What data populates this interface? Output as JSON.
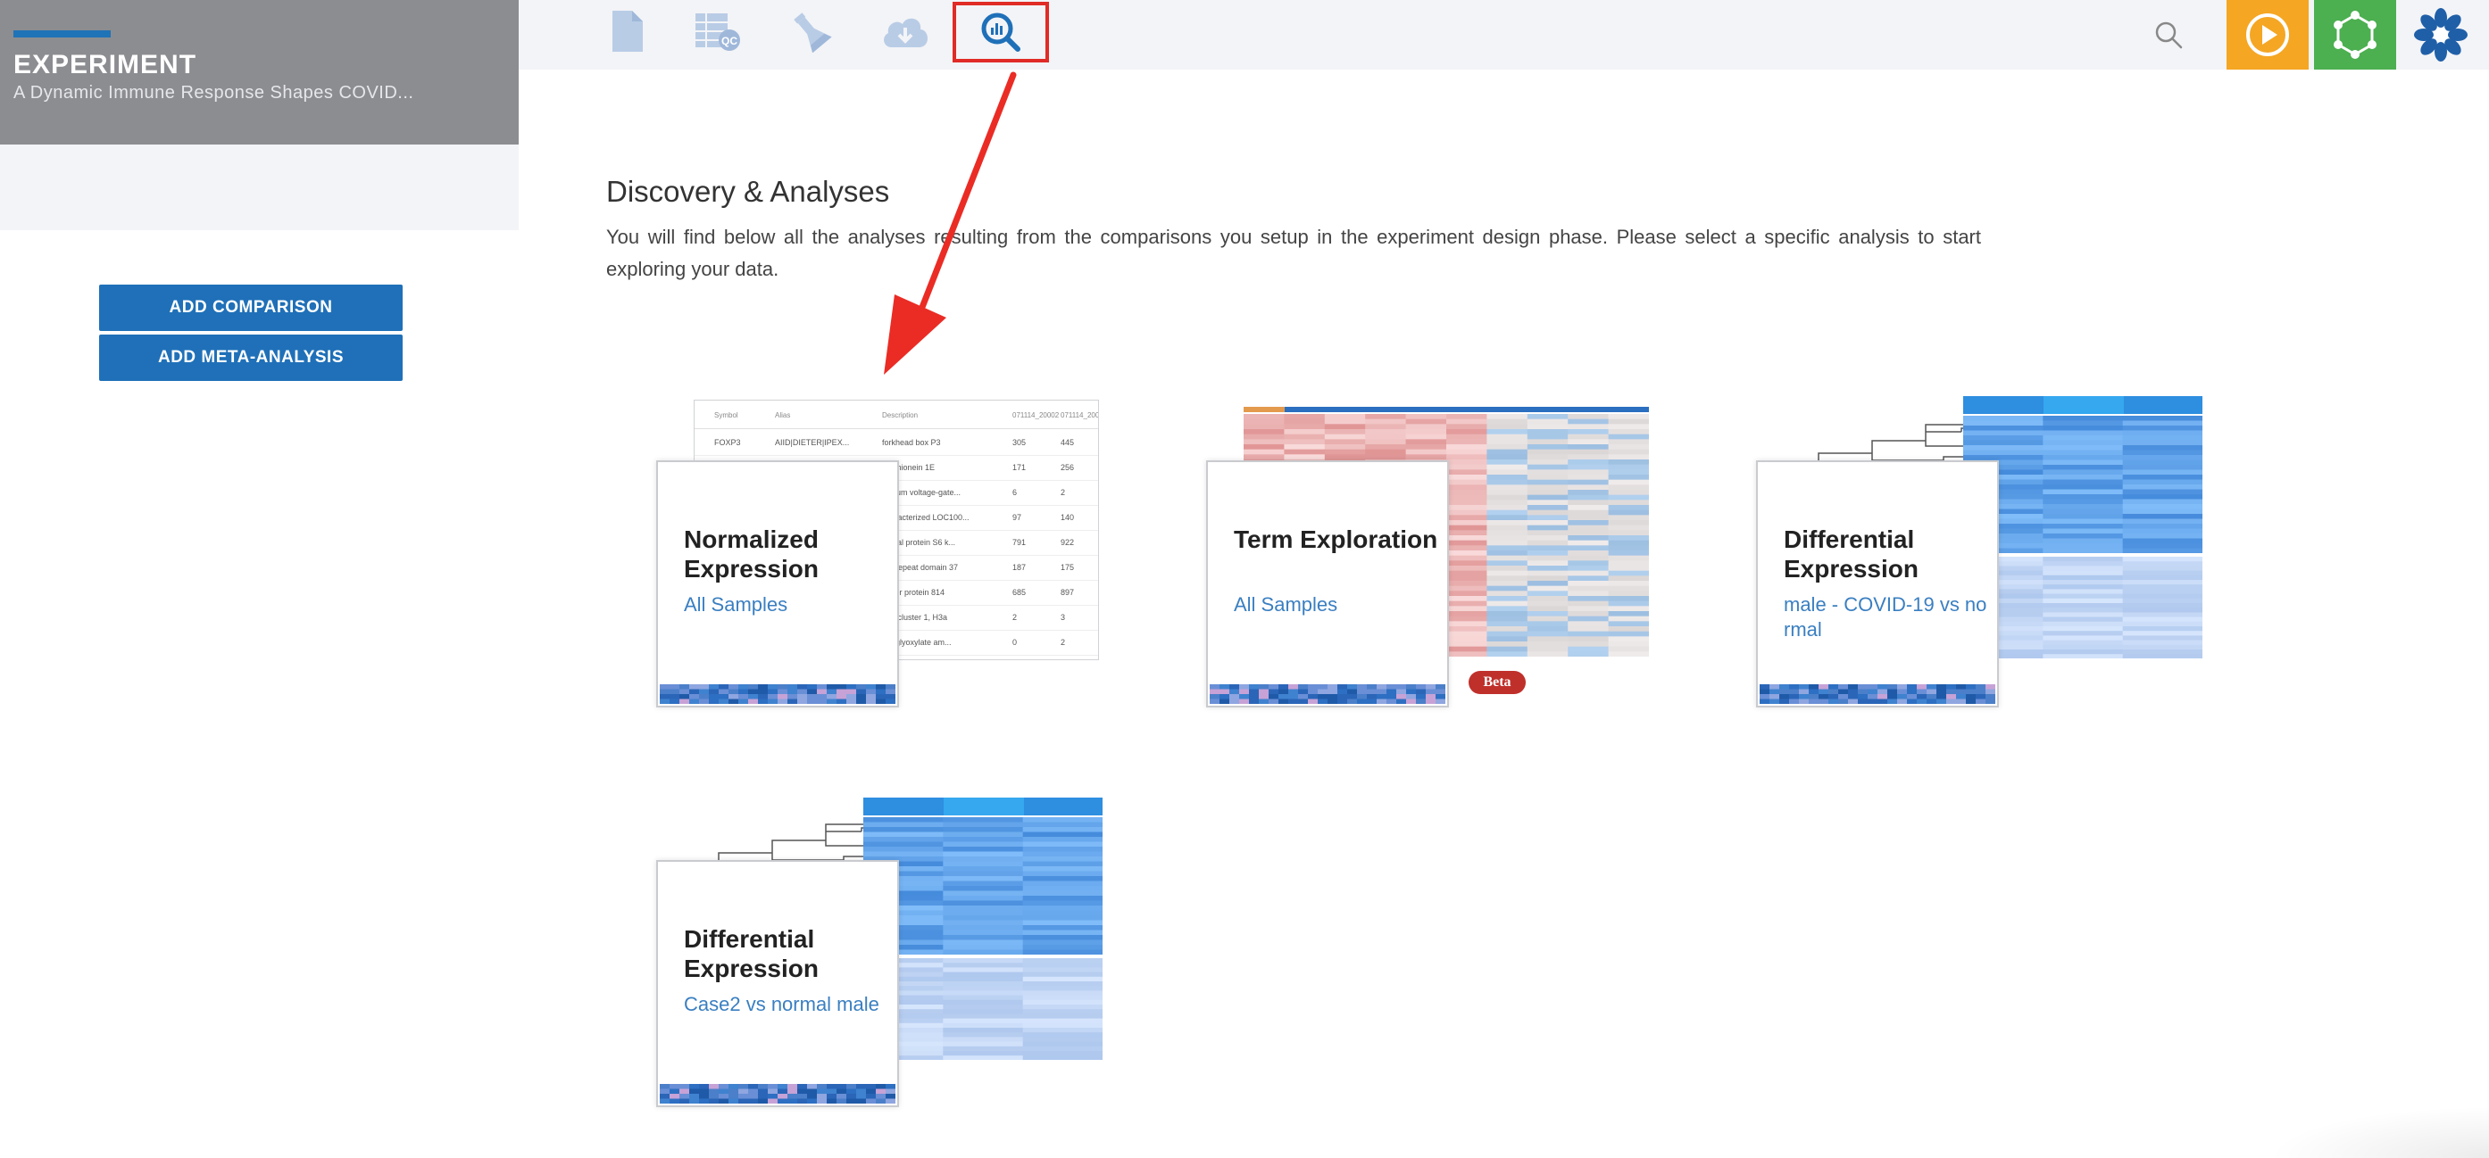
{
  "sidebar": {
    "title": "EXPERIMENT",
    "subtitle": "A Dynamic Immune Response Shapes COVID...",
    "buttons": [
      {
        "label": "ADD COMPARISON"
      },
      {
        "label": "ADD META-ANALYSIS"
      }
    ]
  },
  "topnav": {
    "icons": [
      {
        "name": "document-icon"
      },
      {
        "name": "table-qc-icon"
      },
      {
        "name": "flask-icon"
      },
      {
        "name": "cloud-download-icon"
      },
      {
        "name": "analysis-search-icon",
        "active": true
      }
    ],
    "right": [
      {
        "name": "search-icon"
      },
      {
        "name": "play-icon",
        "color": "#f5a623"
      },
      {
        "name": "network-icon",
        "color": "#4caf50"
      },
      {
        "name": "app-logo-icon"
      }
    ]
  },
  "main": {
    "title": "Discovery & Analyses",
    "description": "You will find below all the analyses resulting from the comparisons you setup in the experiment design phase. Please select a specific analysis to start exploring your data."
  },
  "cards": [
    {
      "title": "Normalized Expression",
      "subtitle": "All Samples",
      "preview": "table"
    },
    {
      "title": "Term Exploration",
      "subtitle": "All Samples",
      "preview": "heatmap-red",
      "badge": "Beta"
    },
    {
      "title": "Differential Expression",
      "subtitle": "male - COVID-19 vs normal",
      "preview": "heatmap-blue"
    },
    {
      "title": "Differential Expression",
      "subtitle": "Case2 vs normal male",
      "preview": "heatmap-blue"
    }
  ],
  "preview_table": {
    "headers": [
      "Symbol",
      "Alias",
      "Description",
      "071114_20002",
      "071114_20002"
    ],
    "rows": [
      [
        "FOXP3",
        "AIID|DIETER|IPEX...",
        "forkhead box P3",
        "305",
        "445"
      ],
      [
        "",
        "",
        "allothionein 1E",
        "171",
        "256"
      ],
      [
        "",
        "",
        "assium voltage-gate...",
        "6",
        "2"
      ],
      [
        "",
        "",
        "characterized LOC100...",
        "97",
        "140"
      ],
      [
        "",
        "",
        "osmal protein S6 k...",
        "791",
        "922"
      ],
      [
        "",
        "",
        "ryn repeat domain 37",
        "187",
        "175"
      ],
      [
        "",
        "",
        "finger protein 814",
        "685",
        "897"
      ],
      [
        "",
        "",
        "one cluster 1, H3a",
        "2",
        "3"
      ],
      [
        "",
        "",
        "ine-glyoxylate am...",
        "0",
        "2"
      ]
    ]
  },
  "colors": {
    "accent": "#1f70b8",
    "highlight": "#e02b26",
    "beta": "#c0302b"
  }
}
